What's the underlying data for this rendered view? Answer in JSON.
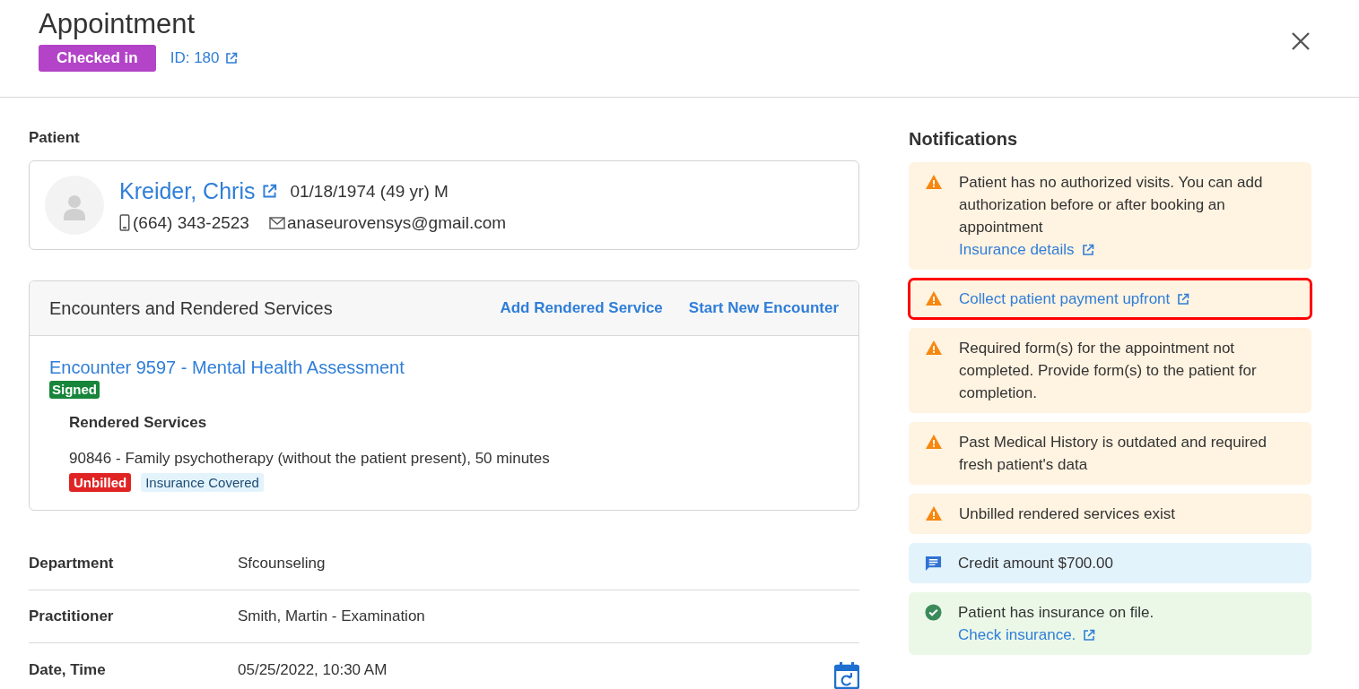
{
  "header": {
    "title": "Appointment",
    "status": "Checked in",
    "id_link": "ID: 180"
  },
  "patient": {
    "label": "Patient",
    "name": "Kreider, Chris",
    "dob": "01/18/1974 (49 yr) M",
    "phone": "(664) 343-2523",
    "email": "anaseurovensys@gmail.com"
  },
  "encounters": {
    "title": "Encounters and Rendered Services",
    "actions": [
      "Add Rendered Service",
      "Start New Encounter"
    ],
    "items": [
      {
        "title": "Encounter 9597 - Mental Health Assessment",
        "status": "Signed",
        "services_label": "Rendered Services",
        "services": [
          {
            "text": "90846 - Family psychotherapy (without the patient present), 50 minutes",
            "tags": [
              {
                "label": "Unbilled",
                "kind": "danger"
              },
              {
                "label": "Insurance Covered",
                "kind": "info"
              }
            ]
          }
        ]
      }
    ]
  },
  "fields": [
    {
      "label": "Department",
      "value": "Sfcounseling"
    },
    {
      "label": "Practitioner",
      "value": "Smith, Martin - Examination"
    },
    {
      "label": "Date, Time",
      "value": "05/25/2022, 10:30 AM",
      "kind": "datetime"
    }
  ],
  "notifications": {
    "title": "Notifications",
    "items": [
      {
        "kind": "warning",
        "text": "Patient has no authorized visits. You can add authorization before or after booking an appointment",
        "link": "Insurance details",
        "highlighted": false
      },
      {
        "kind": "warning",
        "link": "Collect patient payment upfront",
        "highlighted": true
      },
      {
        "kind": "warning",
        "text": "Required form(s) for the appointment not completed. Provide form(s) to the patient for completion.",
        "highlighted": false
      },
      {
        "kind": "warning",
        "text": "Past Medical History is outdated and required fresh patient's data",
        "highlighted": false
      },
      {
        "kind": "warning",
        "text": "Unbilled rendered services exist",
        "highlighted": false
      },
      {
        "kind": "info",
        "text": "Credit amount $700.00",
        "highlighted": false
      },
      {
        "kind": "success",
        "text": "Patient has insurance on file.",
        "link": "Check insurance.",
        "highlighted": false
      }
    ]
  }
}
